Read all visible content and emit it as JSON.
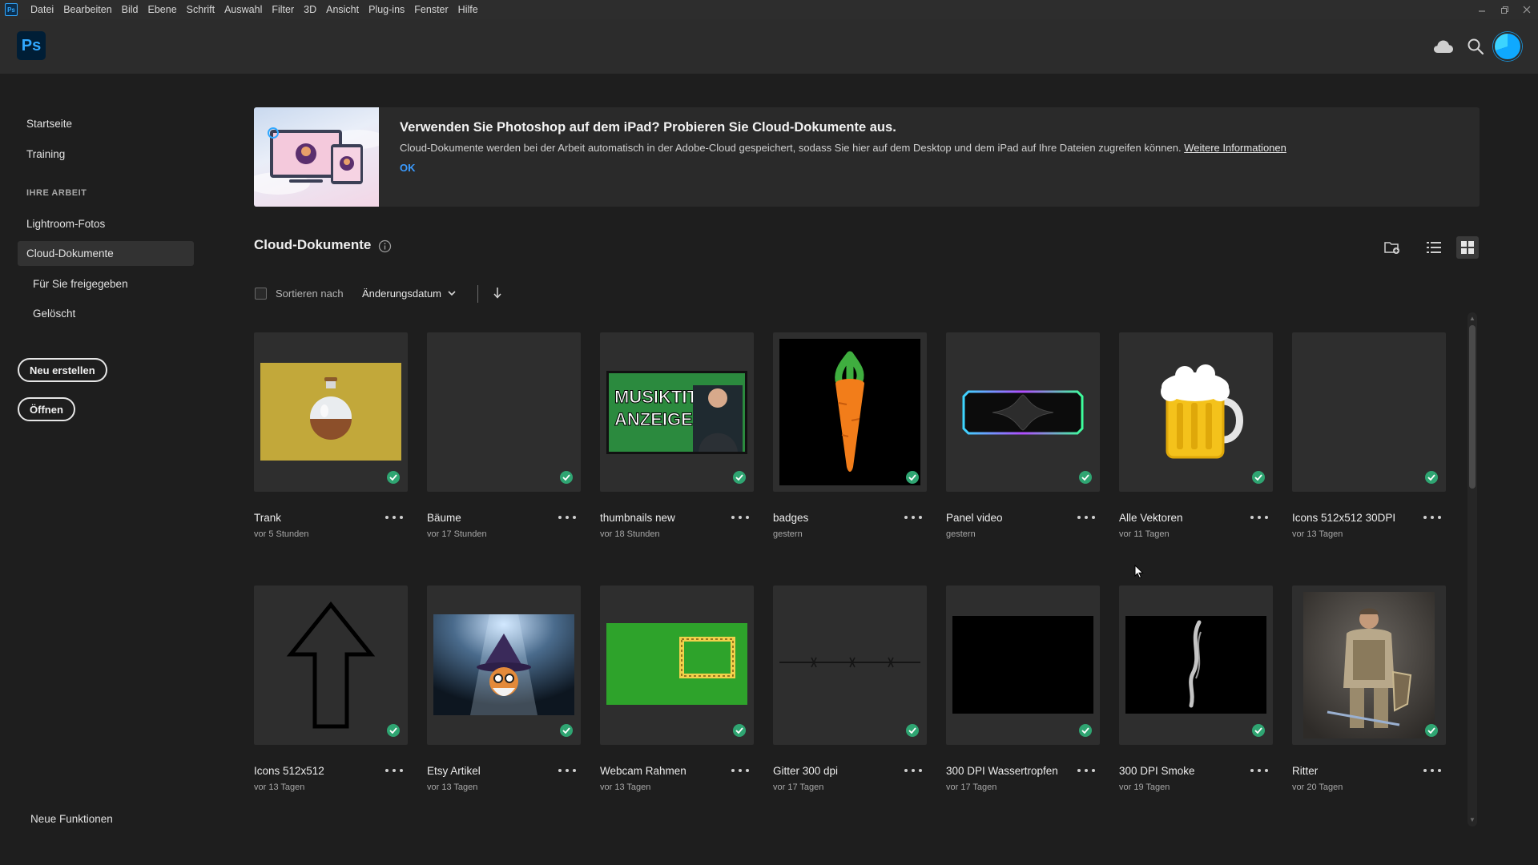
{
  "menubar": {
    "app_badge": "Ps",
    "items": [
      "Datei",
      "Bearbeiten",
      "Bild",
      "Ebene",
      "Schrift",
      "Auswahl",
      "Filter",
      "3D",
      "Ansicht",
      "Plug-ins",
      "Fenster",
      "Hilfe"
    ]
  },
  "header": {
    "logo": "Ps",
    "icons": [
      "cloud-icon",
      "search-icon",
      "avatar"
    ]
  },
  "sidebar": {
    "home": "Startseite",
    "training": "Training",
    "section_heading": "IHRE ARBEIT",
    "lightroom": "Lightroom-Fotos",
    "cloud_docs": "Cloud-Dokumente",
    "shared": "Für Sie freigegeben",
    "deleted": "Gelöscht",
    "new_button": "Neu erstellen",
    "open_button": "Öffnen",
    "whats_new": "Neue Funktionen"
  },
  "banner": {
    "title": "Verwenden Sie Photoshop auf dem iPad? Probieren Sie Cloud-Dokumente aus.",
    "text": "Cloud-Dokumente werden bei der Arbeit automatisch in der Adobe-Cloud gespeichert, sodass Sie hier auf dem Desktop und dem iPad auf Ihre Dateien zugreifen können.",
    "link": "Weitere Informationen",
    "ok": "OK"
  },
  "section": {
    "title": "Cloud-Dokumente"
  },
  "sort": {
    "label": "Sortieren nach",
    "value": "Änderungsdatum"
  },
  "colors": {
    "accent": "#31a8ff",
    "sync_check": "#2fa572",
    "background": "#1e1e1e"
  },
  "documents": [
    {
      "name": "Trank",
      "date": "vor 5 Stunden"
    },
    {
      "name": "Bäume",
      "date": "vor 17 Stunden"
    },
    {
      "name": "thumbnails new",
      "date": "vor 18 Stunden",
      "thumb_text_1": "MUSIKTITEL",
      "thumb_text_2": "ANZEIGEN"
    },
    {
      "name": "badges",
      "date": "gestern"
    },
    {
      "name": "Panel video",
      "date": "gestern"
    },
    {
      "name": "Alle Vektoren",
      "date": "vor 11 Tagen"
    },
    {
      "name": "Icons 512x512 30DPI",
      "date": "vor 13 Tagen"
    },
    {
      "name": "Icons 512x512",
      "date": "vor 13 Tagen"
    },
    {
      "name": "Etsy Artikel",
      "date": "vor 13 Tagen"
    },
    {
      "name": "Webcam Rahmen",
      "date": "vor 13 Tagen"
    },
    {
      "name": "Gitter 300 dpi",
      "date": "vor 17 Tagen"
    },
    {
      "name": "300 DPI Wassertropfen",
      "date": "vor 17 Tagen"
    },
    {
      "name": "300 DPI Smoke",
      "date": "vor 19 Tagen"
    },
    {
      "name": "Ritter",
      "date": "vor 20 Tagen"
    }
  ]
}
